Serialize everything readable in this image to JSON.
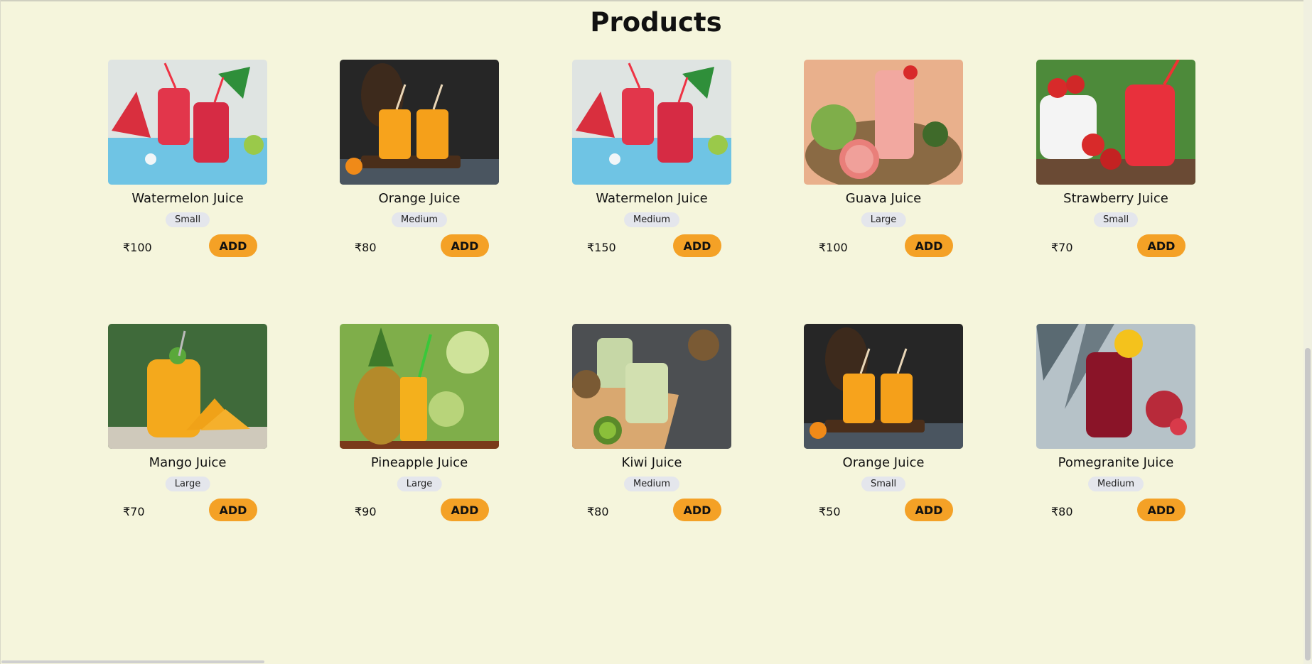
{
  "page": {
    "title": "Products",
    "currency_symbol": "₹",
    "add_label": "ADD"
  },
  "products": [
    {
      "name": "Watermelon Juice",
      "size": "Small",
      "price": "₹100",
      "image": "watermelon-juice"
    },
    {
      "name": "Orange Juice",
      "size": "Medium",
      "price": "₹80",
      "image": "orange-juice"
    },
    {
      "name": "Watermelon Juice",
      "size": "Medium",
      "price": "₹150",
      "image": "watermelon-juice"
    },
    {
      "name": "Guava Juice",
      "size": "Large",
      "price": "₹100",
      "image": "guava-juice"
    },
    {
      "name": "Strawberry Juice",
      "size": "Small",
      "price": "₹70",
      "image": "strawberry-juice"
    },
    {
      "name": "Mango Juice",
      "size": "Large",
      "price": "₹70",
      "image": "mango-juice"
    },
    {
      "name": "Pineapple Juice",
      "size": "Large",
      "price": "₹90",
      "image": "pineapple-juice"
    },
    {
      "name": "Kiwi Juice",
      "size": "Medium",
      "price": "₹80",
      "image": "kiwi-juice"
    },
    {
      "name": "Orange Juice",
      "size": "Small",
      "price": "₹50",
      "image": "orange-juice"
    },
    {
      "name": "Pomegranite Juice",
      "size": "Medium",
      "price": "₹80",
      "image": "pomegranate-juice"
    }
  ],
  "colors": {
    "background": "#f5f5dc",
    "button": "#f4a126",
    "badge": "#e4e6ec"
  }
}
